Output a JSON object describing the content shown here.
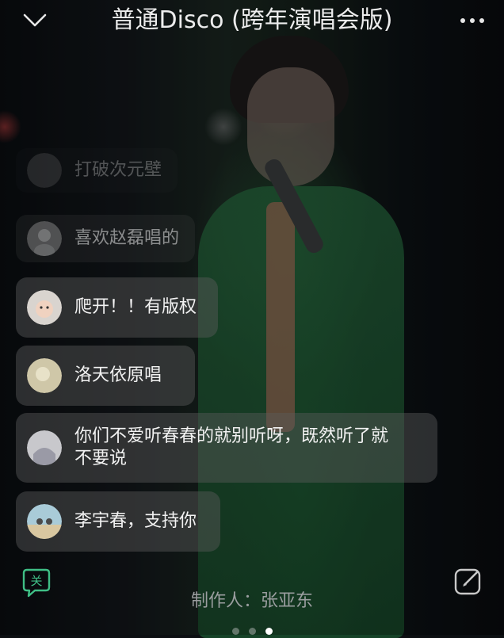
{
  "header": {
    "title": "普通Disco (跨年演唱会版)",
    "back_icon": "chevron-down-icon",
    "more_icon": "more-horizontal-icon"
  },
  "comments": [
    {
      "text": "打破次元壁",
      "avatar": "avatar-placeholder"
    },
    {
      "text": "喜欢赵磊唱的",
      "avatar": "avatar-photo"
    },
    {
      "text": "爬开！！有版权",
      "avatar": "avatar-baby-photo"
    },
    {
      "text": "洛天依原唱",
      "avatar": "avatar-photo"
    },
    {
      "text": "你们不爱听春春的就别听呀，既然听了就",
      "text2": "不要说",
      "avatar": "avatar-photo"
    },
    {
      "text": "李宇春，支持你",
      "avatar": "avatar-beach-photo"
    }
  ],
  "footer": {
    "follow_label": "关",
    "credit_label": "制作人：",
    "credit_name": "张亚东",
    "edit_icon": "edit-icon",
    "page_indicator": {
      "count": 3,
      "active": 3
    }
  },
  "colors": {
    "accent_green": "#3fbf86",
    "text_primary": "#f2f2f2",
    "text_secondary": "#9a9d9f"
  }
}
